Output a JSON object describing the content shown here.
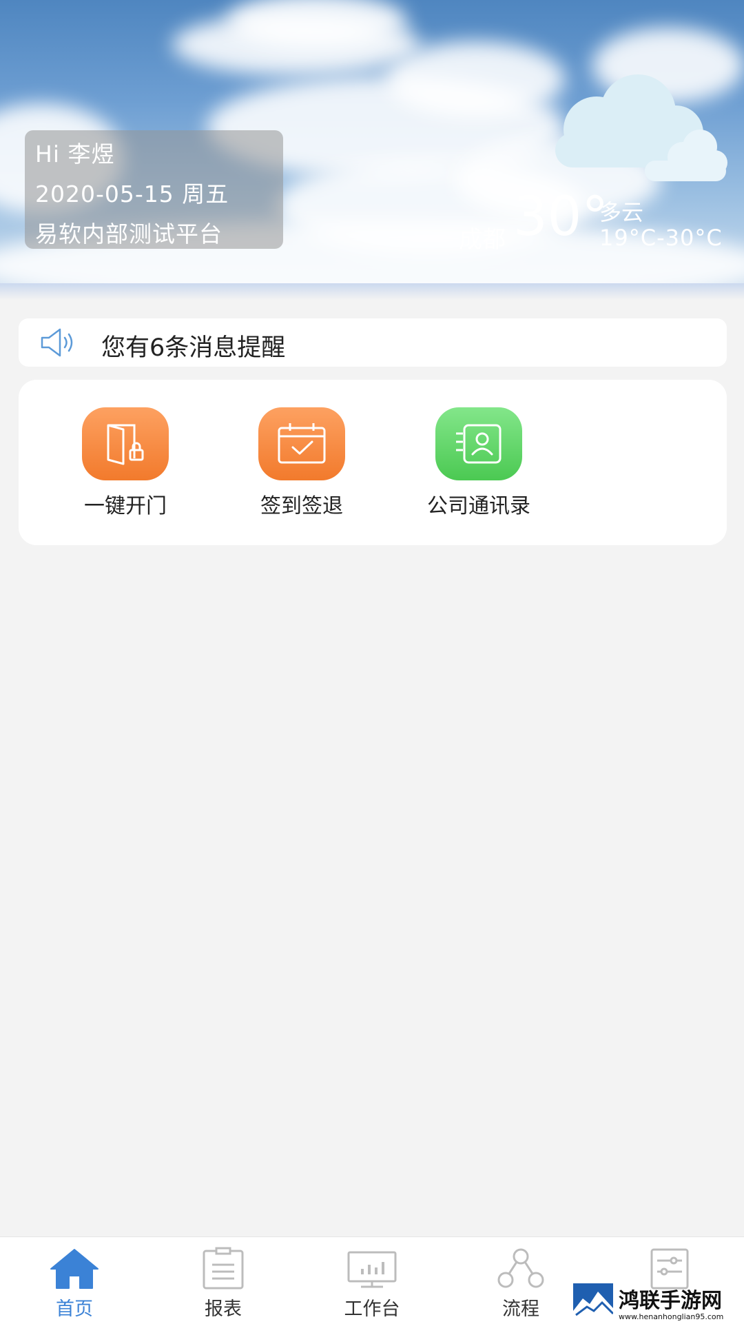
{
  "header": {
    "greeting": "Hi 李煜",
    "date": "2020-05-15 周五",
    "platform": "易软内部测试平台",
    "weather": {
      "city": "成都",
      "temperature": "30°",
      "condition": "多云",
      "range": "19°C-30°C",
      "icon": "cloudy-icon"
    }
  },
  "notice": {
    "icon": "speaker-icon",
    "text": "您有6条消息提醒"
  },
  "apps": [
    {
      "label": "一键开门",
      "icon": "door-lock-icon",
      "color": "#f5843a"
    },
    {
      "label": "签到签退",
      "icon": "calendar-check-icon",
      "color": "#f5843a"
    },
    {
      "label": "公司通讯录",
      "icon": "contact-book-icon",
      "color": "#58cf5e"
    }
  ],
  "tabbar": {
    "active_color": "#3b82d6",
    "items": [
      {
        "label": "首页",
        "icon": "home-icon",
        "active": true
      },
      {
        "label": "报表",
        "icon": "report-icon",
        "active": false
      },
      {
        "label": "工作台",
        "icon": "workbench-icon",
        "active": false
      },
      {
        "label": "流程",
        "icon": "flow-icon",
        "active": false
      },
      {
        "label": "",
        "icon": "settings-sliders-icon",
        "active": false
      }
    ]
  },
  "watermark": {
    "name": "鸿联手游网",
    "url": "www.henanhonglian95.com"
  }
}
